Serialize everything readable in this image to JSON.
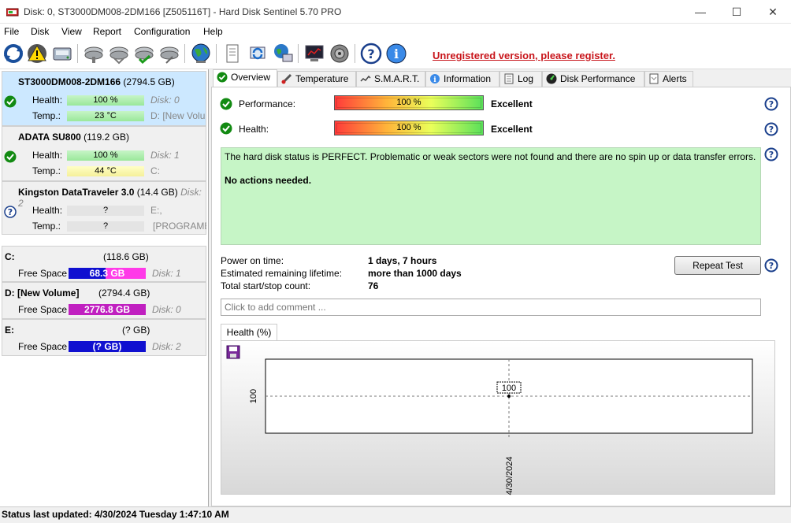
{
  "window": {
    "title": "Disk: 0, ST3000DM008-2DM166 [Z505116T]  -  Hard Disk Sentinel 5.70 PRO",
    "minimize": "—",
    "maximize": "☐",
    "close": "✕"
  },
  "menu": {
    "items": [
      "File",
      "Disk",
      "View",
      "Report",
      "Configuration",
      "Help"
    ]
  },
  "toolbar": {
    "register_text": "Unregistered version, please register.",
    "icons": [
      "refresh-icon",
      "warning-icon",
      "disk-icon",
      "disk-tools-icon",
      "disk-tools-icon",
      "disk-check-icon",
      "disk-tools-icon",
      "globe-icon",
      "document-icon",
      "sync-icon",
      "network-icon",
      "monitor-icon",
      "speaker-icon",
      "help-icon",
      "info-icon"
    ]
  },
  "disks": [
    {
      "name": "ST3000DM008-2DM166",
      "size": "(2794.5 GB)",
      "health_label": "Health:",
      "health": "100 %",
      "health_fraction": 1.0,
      "temp_label": "Temp.:",
      "temp": "23 °C",
      "disk_ref": "Disk: 0",
      "drive_ref": "D: [New Volu",
      "selected": true,
      "status_icon": "ok"
    },
    {
      "name": "ADATA SU800",
      "size": "(119.2 GB)",
      "health_label": "Health:",
      "health": "100 %",
      "health_fraction": 1.0,
      "temp_label": "Temp.:",
      "temp": "44 °C",
      "disk_ref": "Disk: 1",
      "drive_ref": "C:",
      "selected": false,
      "status_icon": "ok"
    },
    {
      "name": "Kingston DataTraveler 3.0",
      "size": "(14.4 GB)",
      "disk_ref_inline": "Disk: 2",
      "health_label": "Health:",
      "health": "?",
      "temp_label": "Temp.:",
      "temp": "?",
      "drive_ref": "E:,",
      "drive_ref2": "[PROGRAME",
      "selected": false,
      "status_icon": "unknown"
    }
  ],
  "volumes": [
    {
      "letter": "C:",
      "size": "(118.6 GB)",
      "free_label": "Free Space",
      "free": "68.3 GB",
      "disk_ref": "Disk: 1",
      "bar_color": "#ff3ae8"
    },
    {
      "letter": "D: [New Volume]",
      "size": "(2794.4 GB)",
      "free_label": "Free Space",
      "free": "2776.8 GB",
      "disk_ref": "Disk: 0",
      "bar_color": "#c020c0"
    },
    {
      "letter": "E:",
      "size": "(? GB)",
      "free_label": "Free Space",
      "free": "(? GB)",
      "disk_ref": "Disk: 2",
      "bar_color": "#1010d0"
    }
  ],
  "tabs": [
    {
      "label": "Overview",
      "icon": "check-icon",
      "active": true
    },
    {
      "label": "Temperature",
      "icon": "thermometer-icon",
      "active": false
    },
    {
      "label": "S.M.A.R.T.",
      "icon": "smart-icon",
      "active": false
    },
    {
      "label": "Information",
      "icon": "info-icon",
      "active": false
    },
    {
      "label": "Log",
      "icon": "log-icon",
      "active": false
    },
    {
      "label": "Disk Performance",
      "icon": "performance-icon",
      "active": false
    },
    {
      "label": "Alerts",
      "icon": "alerts-icon",
      "active": false
    }
  ],
  "overview": {
    "performance_label": "Performance:",
    "performance_value": "100 %",
    "performance_rating": "Excellent",
    "health_label": "Health:",
    "health_value": "100 %",
    "health_rating": "Excellent",
    "status_text": "The hard disk status is PERFECT. Problematic or weak sectors were not found and there are no spin up or data transfer errors.",
    "status_action": "No actions needed.",
    "power_on_label": "Power on time:",
    "power_on_value": "1 days, 7 hours",
    "lifetime_label": "Estimated remaining lifetime:",
    "lifetime_value": "more than 1000 days",
    "startstop_label": "Total start/stop count:",
    "startstop_value": "76",
    "repeat_test": "Repeat Test",
    "comment_placeholder": "Click to add comment ..."
  },
  "chart_tab_label": "Health (%)",
  "chart_data": {
    "type": "line",
    "title": "",
    "x": [
      "4/30/2024"
    ],
    "series": [
      {
        "values": [
          100
        ]
      }
    ],
    "xlabel": "",
    "ylabel": "",
    "y_tick_labels": [
      "100"
    ],
    "data_labels": [
      "100"
    ],
    "grid": true
  },
  "statusbar": {
    "text": "Status last updated: 4/30/2024 Tuesday 1:47:10 AM"
  }
}
